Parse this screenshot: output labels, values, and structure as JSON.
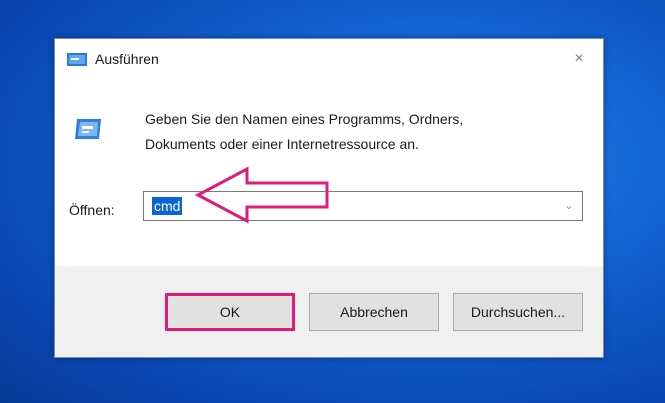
{
  "dialog": {
    "title": "Ausführen",
    "close_symbol": "×",
    "icon": "run-icon",
    "description_line1": "Geben Sie den Namen eines Programms, Ordners,",
    "description_line2": "Dokuments oder einer Internetressource an.",
    "open_label": "Öffnen:",
    "open_value": "cmd",
    "buttons": {
      "ok": "OK",
      "cancel": "Abbrechen",
      "browse": "Durchsuchen..."
    }
  },
  "annotation": {
    "arrow_color": "#e01c79",
    "highlight_color": "#e01c79"
  }
}
